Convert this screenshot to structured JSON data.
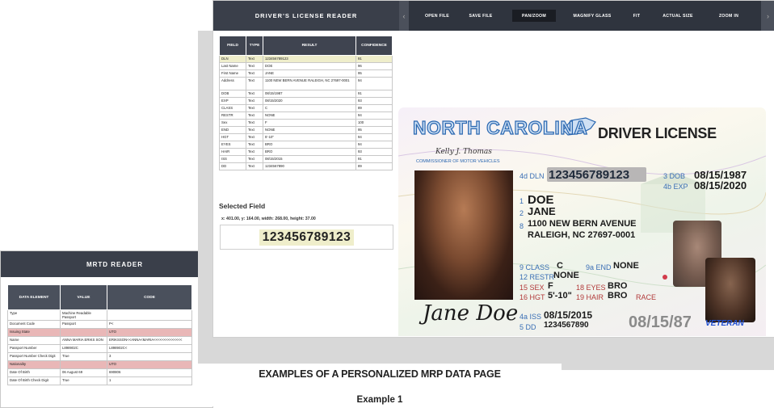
{
  "mrtd": {
    "title": "MRTD READER",
    "columns": [
      "DATA ELEMENT",
      "VALUE",
      "CODE"
    ],
    "rows": [
      {
        "element": "Type",
        "value": "Machine Readable Passport",
        "code": "",
        "hl": false
      },
      {
        "element": "Document Code",
        "value": "Passport",
        "code": "P<",
        "hl": false
      },
      {
        "element": "Issuing State",
        "value": "",
        "code": "UTO",
        "hl": true
      },
      {
        "element": "Name",
        "value": "ANNA MARIA ERIKS SON",
        "code": "ERIKSSON<<ANNA<MARIA<<<<<<<<<<<<<<",
        "hl": false
      },
      {
        "element": "Passport Number",
        "value": "L898902C",
        "code": "L898902C<",
        "hl": false
      },
      {
        "element": "Passport Number Check Digit",
        "value": "True",
        "code": "3",
        "hl": false
      },
      {
        "element": "Nationality",
        "value": "",
        "code": "UTO",
        "hl": true
      },
      {
        "element": "Date Of Birth",
        "value": "06 August 69",
        "code": "690806",
        "hl": false
      },
      {
        "element": "Date Of Birth Check Digit",
        "value": "True",
        "code": "1",
        "hl": false
      }
    ]
  },
  "dl_reader": {
    "title": "DRIVER'S LICENSE READER",
    "toolbar": [
      {
        "label": "OPEN FILE",
        "active": false
      },
      {
        "label": "SAVE FILE",
        "active": false
      },
      {
        "label": "PAN/ZOOM",
        "active": true
      },
      {
        "label": "MAGNIFY GLASS",
        "active": false
      },
      {
        "label": "FIT",
        "active": false
      },
      {
        "label": "ACTUAL SIZE",
        "active": false
      },
      {
        "label": "ZOOM IN",
        "active": false
      }
    ],
    "columns": [
      "FIELD",
      "TYPE",
      "RESULT",
      "CONFIDENCE"
    ],
    "rows": [
      {
        "field": "DLN",
        "type": "Text",
        "result": "123456789123",
        "confidence": "91",
        "selected": true
      },
      {
        "field": "Last Name",
        "type": "Text",
        "result": "DOE",
        "confidence": "96",
        "selected": false
      },
      {
        "field": "First Name",
        "type": "Text",
        "result": "JANE",
        "confidence": "95",
        "selected": false
      },
      {
        "field": "Address",
        "type": "Text",
        "result": "1100 NEW BERN AVENUE RALEIGH, NC 27697-0001",
        "confidence": "94",
        "selected": false
      },
      {
        "field": "DOB",
        "type": "Text",
        "result": "08/15/1987",
        "confidence": "91",
        "selected": false
      },
      {
        "field": "EXP",
        "type": "Text",
        "result": "08/15/2020",
        "confidence": "93",
        "selected": false
      },
      {
        "field": "CLASS",
        "type": "Text",
        "result": "C",
        "confidence": "89",
        "selected": false
      },
      {
        "field": "RESTR",
        "type": "Text",
        "result": "NONE",
        "confidence": "94",
        "selected": false
      },
      {
        "field": "Sex",
        "type": "Text",
        "result": "F",
        "confidence": "100",
        "selected": false
      },
      {
        "field": "END",
        "type": "Text",
        "result": "NONE",
        "confidence": "95",
        "selected": false
      },
      {
        "field": "HGT",
        "type": "Text",
        "result": "5'-10\"",
        "confidence": "94",
        "selected": false
      },
      {
        "field": "EYES",
        "type": "Text",
        "result": "BRO",
        "confidence": "94",
        "selected": false
      },
      {
        "field": "HAIR",
        "type": "Text",
        "result": "BRO",
        "confidence": "93",
        "selected": false
      },
      {
        "field": "ISS",
        "type": "Text",
        "result": "08/15/2015",
        "confidence": "91",
        "selected": false
      },
      {
        "field": "DD",
        "type": "Text",
        "result": "1234567890",
        "confidence": "89",
        "selected": false
      }
    ],
    "selected_field": {
      "label": "Selected Field",
      "coords": "x: 401.00, y: 164.00, width: 268.00, height: 37.00",
      "value": "123456789123"
    }
  },
  "license": {
    "state": "NORTH CAROLINA",
    "heading": "DRIVER LICENSE",
    "commissioner_sig": "Kelly J. Thomas",
    "commissioner_title": "COMMISSIONER OF MOTOR VEHICLES",
    "dln_label": "4d DLN",
    "dln": "123456789123",
    "dob_label": "3  DOB",
    "dob": "08/15/1987",
    "exp_label": "4b EXP",
    "exp": "08/15/2020",
    "last_name_num": "1",
    "last_name": "DOE",
    "first_name_num": "2",
    "first_name": "JANE",
    "addr_num": "8",
    "addr1": "1100 NEW BERN AVENUE",
    "addr2": "RALEIGH, NC 27697-0001",
    "class_label": "9  CLASS",
    "class": "C",
    "end_label": "9a END",
    "end": "NONE",
    "restr_label": "12 RESTR",
    "restr": "NONE",
    "sex_label": "15 SEX",
    "sex": "F",
    "eyes_label": "18 EYES",
    "eyes": "BRO",
    "hgt_label": "16 HGT",
    "hgt": "5'-10\"",
    "hair_label": "19 HAIR",
    "hair": "BRO",
    "race_label": "RACE",
    "iss_label": "4a ISS",
    "iss": "08/15/2015",
    "dd_label": "5  DD",
    "dd": "1234567890",
    "dob_ghost": "08/15/87",
    "veteran": "VETERAN",
    "signature": "Jane Doe"
  },
  "page": {
    "title": "EXAMPLES OF A PERSONALIZED MRP DATA PAGE",
    "subtitle": "Example 1"
  },
  "colors": {
    "header": "#3a3f4a",
    "toolbar": "#2f343e",
    "selected_row": "#efeecb",
    "mrtd_highlight": "#e9b7b7",
    "license_blue": "#2a67b0"
  }
}
